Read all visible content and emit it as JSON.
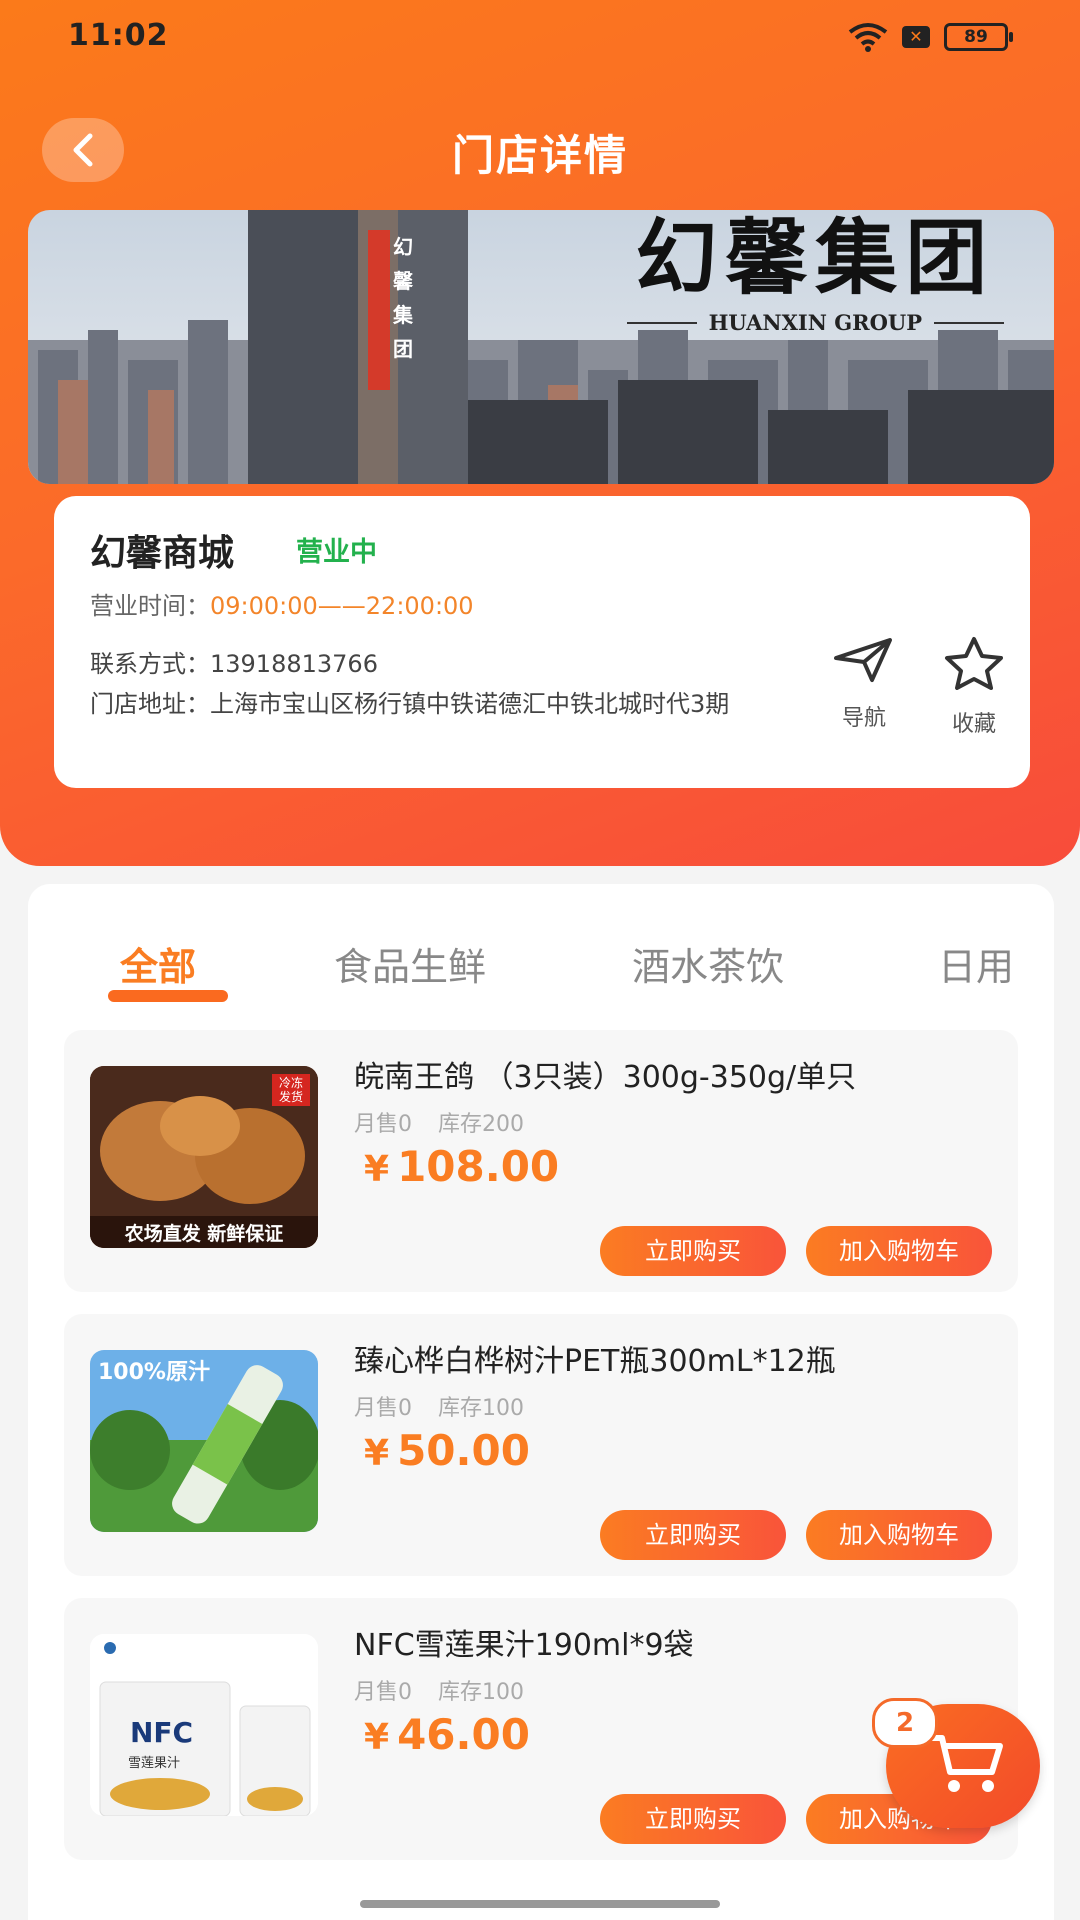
{
  "status_bar": {
    "time": "11:02",
    "battery": "89"
  },
  "header": {
    "title": "门店详情"
  },
  "banner": {
    "brand_cn": "幻馨集团",
    "brand_en": "HUANXIN GROUP",
    "tower_text": "幻馨集团"
  },
  "store": {
    "name": "幻馨商城",
    "status": "营业中",
    "hours_label": "营业时间：",
    "hours": "09:00:00——22:00:00",
    "contact_label": "联系方式：",
    "contact": "13918813766",
    "address_label": "门店地址：",
    "address": "上海市宝山区杨行镇中铁诺德汇中铁北城时代3期",
    "nav_label": "导航",
    "fav_label": "收藏"
  },
  "tabs": [
    {
      "label": "全部"
    },
    {
      "label": "食品生鲜"
    },
    {
      "label": "酒水茶饮"
    },
    {
      "label": "日用"
    }
  ],
  "currency": "¥",
  "products": [
    {
      "name": "皖南王鸽 （3只装）300g-350g/单只",
      "monthly_sales": "月售0",
      "stock": "库存200",
      "price": "108.00",
      "img_caption": "农场直发 新鲜保证",
      "img_tag": "冷冻发货"
    },
    {
      "name": "臻心桦白桦树汁PET瓶300mL*12瓶",
      "monthly_sales": "月售0",
      "stock": "库存100",
      "price": "50.00",
      "img_caption": "100%原汁"
    },
    {
      "name": "NFC雪莲果汁190ml*9袋",
      "monthly_sales": "月售0",
      "stock": "库存100",
      "price": "46.00",
      "img_caption": "NFC",
      "img_sub": "雪莲果汁"
    }
  ],
  "buttons": {
    "buy_now": "立即购买",
    "add_cart": "加入购物车"
  },
  "cart": {
    "count": "2"
  }
}
